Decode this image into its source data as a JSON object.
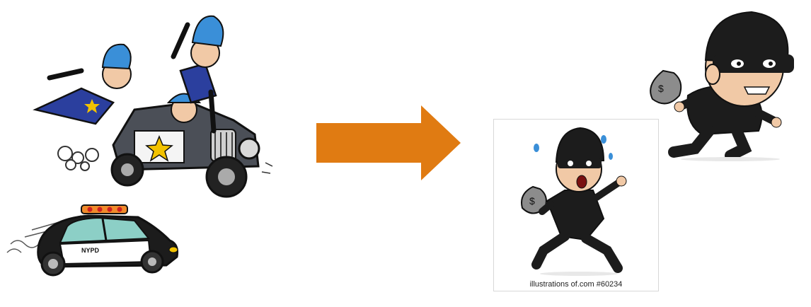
{
  "images": {
    "cops": {
      "icon": "police-officers-chasing-icon"
    },
    "police_car": {
      "icon": "police-car-icon",
      "door_text": "NYPD"
    },
    "arrow": {
      "icon": "right-arrow-icon",
      "color": "#E07B12"
    },
    "robber_card": {
      "icon": "running-robber-icon",
      "caption": "illustrations of.com     #60234"
    },
    "robber_right": {
      "icon": "running-burglar-icon",
      "bag_symbol": "$"
    }
  },
  "colors": {
    "cop_hat": "#3a8fd8",
    "uniform": "#2b3f9e",
    "robber_black": "#1c1c1c",
    "money_bag": "#8c8c8c",
    "star": "#f2c200"
  }
}
